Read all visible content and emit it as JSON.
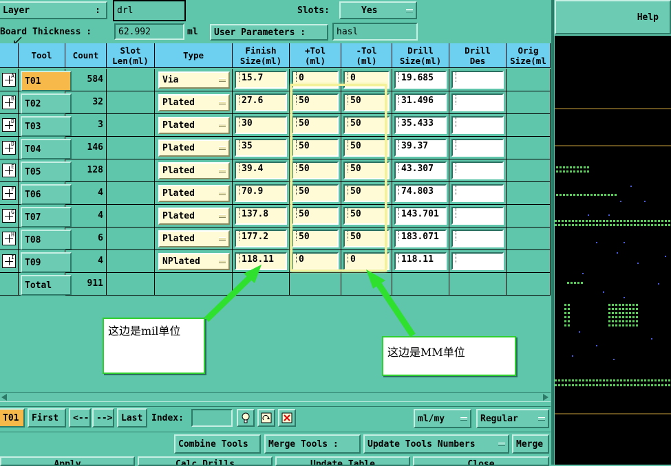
{
  "top": {
    "layer_label": "Layer",
    "layer_colon": ":",
    "layer_value": "drl",
    "slots_label": "Slots:",
    "slots_value": "Yes",
    "help_label": "Help",
    "board_thickness_label": "Board Thickness :",
    "board_thickness_value": "62.992",
    "board_thickness_unit": "ml",
    "user_params_label": "User Parameters :",
    "user_params_value": "hasl"
  },
  "table": {
    "headers": [
      "Tool",
      "Count",
      "Slot\nLen(ml)",
      "Type",
      "Finish\nSize(ml)",
      "+Tol\n(ml)",
      "-Tol\n(ml)",
      "Drill\nSize(ml)",
      "Drill\nDes",
      "Orig\nSize(ml"
    ],
    "rows": [
      {
        "icon": "A",
        "tool": "T01",
        "count": "584",
        "type": "Via",
        "finish": "15.7",
        "ptol": "0",
        "ntol": "0",
        "drill": "19.685",
        "des": ""
      },
      {
        "icon": "B",
        "tool": "T02",
        "count": "32",
        "type": "Plated",
        "finish": "27.6",
        "ptol": "50",
        "ntol": "50",
        "drill": "31.496",
        "des": ""
      },
      {
        "icon": "D",
        "tool": "T03",
        "count": "3",
        "type": "Plated",
        "finish": "30",
        "ptol": "50",
        "ntol": "50",
        "drill": "35.433",
        "des": ""
      },
      {
        "icon": "D",
        "tool": "T04",
        "count": "146",
        "type": "Plated",
        "finish": "35",
        "ptol": "50",
        "ntol": "50",
        "drill": "39.37",
        "des": ""
      },
      {
        "icon": "E",
        "tool": "T05",
        "count": "128",
        "type": "Plated",
        "finish": "39.4",
        "ptol": "50",
        "ntol": "50",
        "drill": "43.307",
        "des": ""
      },
      {
        "icon": "F",
        "tool": "T06",
        "count": "4",
        "type": "Plated",
        "finish": "70.9",
        "ptol": "50",
        "ntol": "50",
        "drill": "74.803",
        "des": ""
      },
      {
        "icon": "G",
        "tool": "T07",
        "count": "4",
        "type": "Plated",
        "finish": "137.8",
        "ptol": "50",
        "ntol": "50",
        "drill": "143.701",
        "des": ""
      },
      {
        "icon": "H",
        "tool": "T08",
        "count": "6",
        "type": "Plated",
        "finish": "177.2",
        "ptol": "50",
        "ntol": "50",
        "drill": "183.071",
        "des": ""
      },
      {
        "icon": "I",
        "tool": "T09",
        "count": "4",
        "type": "NPlated",
        "finish": "118.11",
        "ptol": "0",
        "ntol": "0",
        "drill": "118.11",
        "des": ""
      }
    ],
    "total_label": "Total",
    "total_count": "911"
  },
  "annotations": {
    "mil_note": "这边是mil单位",
    "mm_note": "这边是MM单位"
  },
  "nav": {
    "current_tool": "T01",
    "first": "First",
    "prev": "<--",
    "next": "-->",
    "last": "Last",
    "index_label": "Index:",
    "index_value": "",
    "units_value": "ml/my",
    "mode_value": "Regular"
  },
  "actions": {
    "combine_tools": "Combine Tools",
    "merge_tools_label": "Merge Tools :",
    "update_tools_numbers": "Update Tools Numbers",
    "merge": "Merge",
    "apply": "Apply",
    "calc_drills": "Calc Drills",
    "update_table": "Update Table",
    "close": "Close"
  },
  "colors": {
    "panel": "#5fc5ab",
    "header": "#6ed0f1",
    "input": "#fffbd6",
    "highlight_tool": "#f6b94a",
    "callout_border": "#2fcf2f",
    "preview_bg": "#000000"
  }
}
